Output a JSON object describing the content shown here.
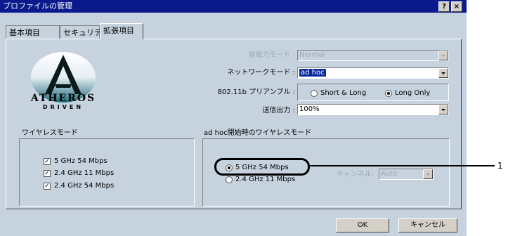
{
  "window": {
    "title": "プロファイルの管理",
    "help_label": "?",
    "close_label": "×"
  },
  "tabs": [
    {
      "label": "基本項目"
    },
    {
      "label": "セキュリティ"
    },
    {
      "label": "拡張項目"
    }
  ],
  "logo": {
    "brand": "ATHEROS",
    "sub": "DRIVEN"
  },
  "settings": {
    "power_label": "省電力モード :",
    "power_value": "Normal",
    "network_label": "ネットワークモード :",
    "network_value": "ad hoc",
    "preamble_label": "802.11b プリアンブル :",
    "preamble_short_long": "Short & Long",
    "preamble_long_only": "Long Only",
    "txpower_label": "送信出力 :",
    "txpower_value": "100%"
  },
  "wireless_mode": {
    "title": "ワイヤレスモード",
    "options": [
      {
        "label": "5 GHz 54 Mbps",
        "checked": true
      },
      {
        "label": "2.4 GHz 11 Mbps",
        "checked": true
      },
      {
        "label": "2.4 GHz 54 Mbps",
        "checked": true
      }
    ]
  },
  "adhoc_mode": {
    "title": "ad hoc開始時のワイヤレスモード",
    "options": [
      {
        "label": "5 GHz 54 Mbps",
        "selected": true
      },
      {
        "label": "2.4 GHz 11 Mbps",
        "selected": false
      }
    ],
    "channel_label": "チャンネル:",
    "channel_value": "Auto"
  },
  "buttons": {
    "ok": "OK",
    "cancel": "キャンセル"
  },
  "callout": {
    "number": "1"
  },
  "colors": {
    "titlebar": "#0a1a8c",
    "window_bg": "#c6d3df",
    "selection": "#0a2a9c"
  }
}
